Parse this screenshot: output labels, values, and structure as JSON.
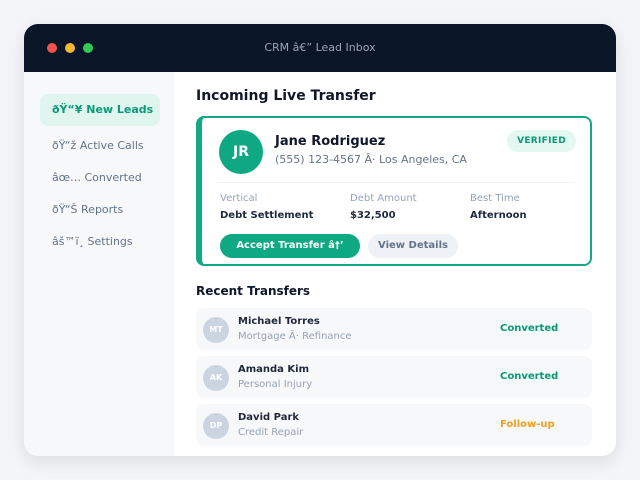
{
  "window": {
    "title": "CRM â€” Lead Inbox"
  },
  "sidebar": {
    "items": [
      {
        "label": "ðŸ“¥ New Leads",
        "active": true
      },
      {
        "label": "ðŸ“ž Active Calls",
        "active": false
      },
      {
        "label": "âœ… Converted",
        "active": false
      },
      {
        "label": "ðŸ“Š Reports",
        "active": false
      },
      {
        "label": "âš™ï¸ Settings",
        "active": false
      }
    ]
  },
  "main": {
    "title": "Incoming Live Transfer",
    "transfer": {
      "initials": "JR",
      "name": "Jane Rodriguez",
      "subtitle": "(555) 123-4567 Â· Los Angeles, CA",
      "badge": "VERIFIED",
      "fields": [
        {
          "label": "Vertical",
          "value": "Debt Settlement"
        },
        {
          "label": "Debt Amount",
          "value": "$32,500"
        },
        {
          "label": "Best Time",
          "value": "Afternoon"
        }
      ],
      "accept_label": "Accept Transfer â†’",
      "details_label": "View Details"
    },
    "recent_title": "Recent Transfers",
    "recent": [
      {
        "initials": "MT",
        "name": "Michael Torres",
        "category": "Mortgage Â· Refinance",
        "status": "Converted",
        "status_color": "#0b9a78"
      },
      {
        "initials": "AK",
        "name": "Amanda Kim",
        "category": "Personal Injury",
        "status": "Converted",
        "status_color": "#0b9a78"
      },
      {
        "initials": "DP",
        "name": "David Park",
        "category": "Credit Repair",
        "status": "Follow-up",
        "status_color": "#f0a020"
      }
    ]
  },
  "colors": {
    "accent": "#0ea882",
    "titlebar": "#0b1528"
  }
}
